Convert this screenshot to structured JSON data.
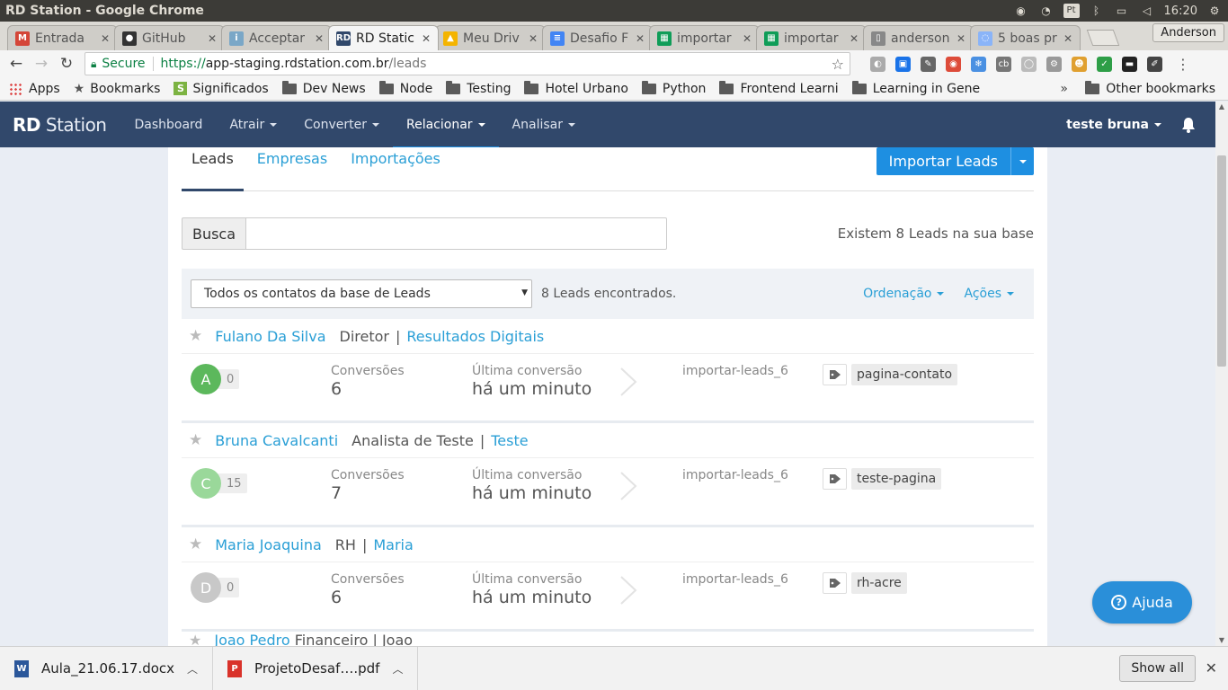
{
  "os": {
    "window_title": "RD Station - Google Chrome",
    "lang": "Pt",
    "clock": "16:20"
  },
  "browser": {
    "tabs": [
      {
        "label": "Entrada",
        "icon": "gmail-icon",
        "color": "#d44638",
        "glyph": "M",
        "active": false
      },
      {
        "label": "GitHub",
        "icon": "github-icon",
        "color": "#333333",
        "glyph": "●",
        "active": false
      },
      {
        "label": "Acceptar",
        "icon": "info-icon",
        "color": "#7aa7c7",
        "glyph": "i",
        "active": false
      },
      {
        "label": "RD Static",
        "icon": "rd-icon",
        "color": "#31486b",
        "glyph": "RD",
        "active": true
      },
      {
        "label": "Meu Driv",
        "icon": "drive-icon",
        "color": "#f4b400",
        "glyph": "▲",
        "active": false
      },
      {
        "label": "Desafio F",
        "icon": "docs-icon",
        "color": "#4285f4",
        "glyph": "≡",
        "active": false
      },
      {
        "label": "importar",
        "icon": "sheets-icon",
        "color": "#0f9d58",
        "glyph": "▦",
        "active": false
      },
      {
        "label": "importar",
        "icon": "sheets-icon",
        "color": "#0f9d58",
        "glyph": "▦",
        "active": false
      },
      {
        "label": "anderson",
        "icon": "file-icon",
        "color": "#888888",
        "glyph": "▯",
        "active": false
      },
      {
        "label": "5 boas pr",
        "icon": "loading-icon",
        "color": "#8ab4f8",
        "glyph": "◌",
        "active": false
      }
    ],
    "profile_name": "Anderson",
    "secure_label": "Secure",
    "url_https": "https://",
    "url_host": "app-staging.rdstation.com.br",
    "url_path": "/leads",
    "bookmarks": [
      {
        "label": "Apps",
        "type": "apps"
      },
      {
        "label": "Bookmarks",
        "type": "star"
      },
      {
        "label": "Significados",
        "type": "site"
      },
      {
        "label": "Dev News",
        "type": "folder"
      },
      {
        "label": "Node",
        "type": "folder"
      },
      {
        "label": "Testing",
        "type": "folder"
      },
      {
        "label": "Hotel Urbano",
        "type": "folder"
      },
      {
        "label": "Python",
        "type": "folder"
      },
      {
        "label": "Frontend Learni",
        "type": "folder"
      },
      {
        "label": "Learning in Gene",
        "type": "folder"
      }
    ],
    "bookmarks_more": "»",
    "other_bookmarks": "Other bookmarks"
  },
  "app": {
    "brand_bold": "RD",
    "brand_rest": " Station",
    "nav": [
      {
        "label": "Dashboard",
        "dropdown": false,
        "active": false
      },
      {
        "label": "Atrair",
        "dropdown": true,
        "active": false
      },
      {
        "label": "Converter",
        "dropdown": true,
        "active": false
      },
      {
        "label": "Relacionar",
        "dropdown": true,
        "active": true
      },
      {
        "label": "Analisar",
        "dropdown": true,
        "active": false
      }
    ],
    "user_name": "teste bruna"
  },
  "page": {
    "subtabs": [
      "Leads",
      "Empresas",
      "Importações"
    ],
    "import_button": "Importar Leads",
    "search_label": "Busca",
    "search_value": "",
    "lead_count_text": "Existem 8 Leads na sua base",
    "filter_selected": "Todos os contatos da base de Leads",
    "found_text": "8 Leads encontrados.",
    "sort_label": "Ordenação",
    "actions_label": "Ações",
    "conversions_label": "Conversões",
    "last_conversion_label": "Última conversão",
    "leads": [
      {
        "name": "Fulano Da Silva",
        "role": "Diretor",
        "company": "Resultados Digitais",
        "stage": "A",
        "stage_color": "#5cb85c",
        "score": "0",
        "conversions": "6",
        "last_conversion": "há um minuto",
        "source": "importar-leads_6",
        "tag": "pagina-contato"
      },
      {
        "name": "Bruna Cavalcanti",
        "role": "Analista de Teste",
        "company": "Teste",
        "stage": "C",
        "stage_color": "#9ad89a",
        "score": "15",
        "conversions": "7",
        "last_conversion": "há um minuto",
        "source": "importar-leads_6",
        "tag": "teste-pagina"
      },
      {
        "name": "Maria Joaquina",
        "role": "RH",
        "company": "Maria",
        "stage": "D",
        "stage_color": "#c8c8c8",
        "score": "0",
        "conversions": "6",
        "last_conversion": "há um minuto",
        "source": "importar-leads_6",
        "tag": "rh-acre"
      }
    ],
    "partial_lead_name": "Joao Pedro",
    "partial_lead_role": "Financeiro | Joao"
  },
  "help_button": "Ajuda",
  "downloads": {
    "items": [
      {
        "name": "Aula_21.06.17.docx",
        "icon": "word-icon",
        "color": "#2b579a",
        "glyph": "W"
      },
      {
        "name": "ProjetoDesaf….pdf",
        "icon": "pdf-icon",
        "color": "#d9322a",
        "glyph": "P"
      }
    ],
    "show_all": "Show all"
  },
  "colors": {
    "nav_bg": "#31486b",
    "accent": "#1e8fe1",
    "link": "#2a9fd6"
  }
}
